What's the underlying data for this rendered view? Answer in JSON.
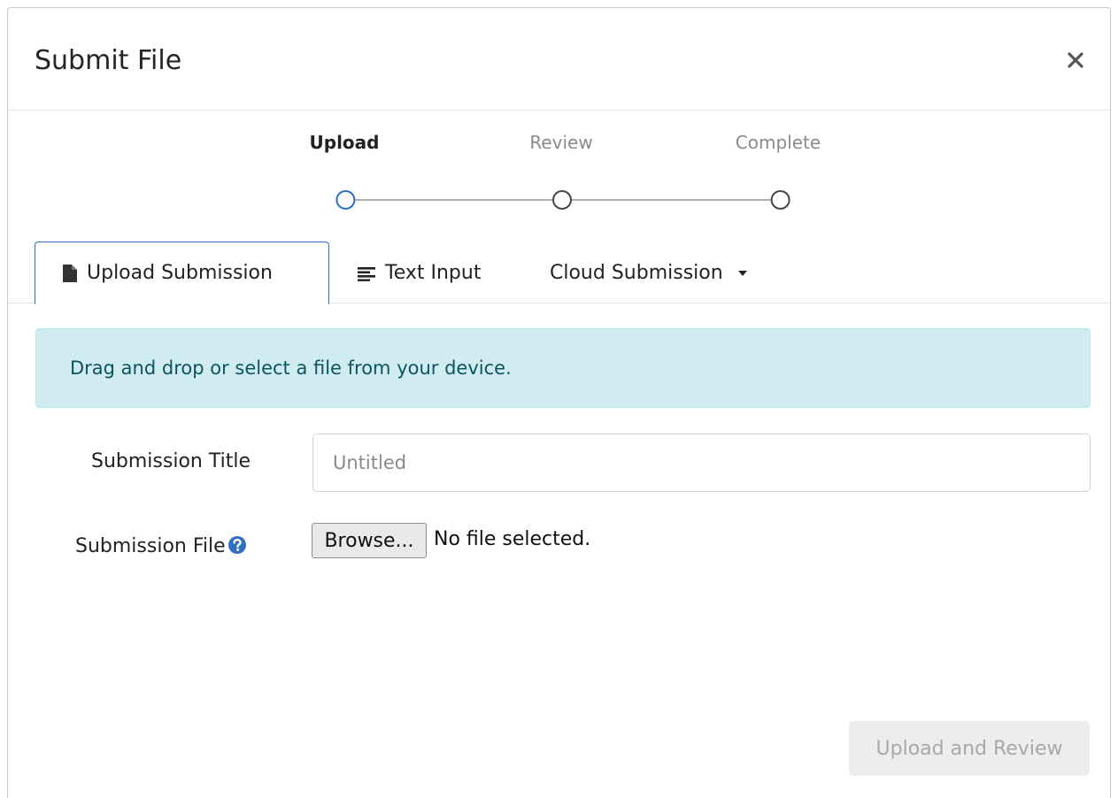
{
  "modal": {
    "title": "Submit File",
    "close_label": "×"
  },
  "steps": [
    {
      "label": "Upload",
      "state": "active"
    },
    {
      "label": "Review",
      "state": "inactive"
    },
    {
      "label": "Complete",
      "state": "inactive"
    }
  ],
  "tabs": [
    {
      "label": "Upload Submission",
      "icon": "file-icon",
      "active": true
    },
    {
      "label": "Text Input",
      "icon": "text-lines-icon",
      "active": false
    },
    {
      "label": "Cloud Submission",
      "icon": "caret-down-icon",
      "active": false
    }
  ],
  "alert": {
    "text": "Drag and drop or select a file from your device."
  },
  "form": {
    "title_label": "Submission Title",
    "title_placeholder": "Untitled",
    "title_value": "",
    "file_label": "Submission File",
    "browse_label": "Browse...",
    "file_status": "No file selected."
  },
  "footer": {
    "submit_label": "Upload and Review"
  },
  "colors": {
    "active_tab_border": "#2f6fc3",
    "step_active": "#2f6fc3",
    "alert_bg": "#d1ecf1",
    "alert_text": "#0c5460",
    "help_icon": "#2f6fc3"
  }
}
